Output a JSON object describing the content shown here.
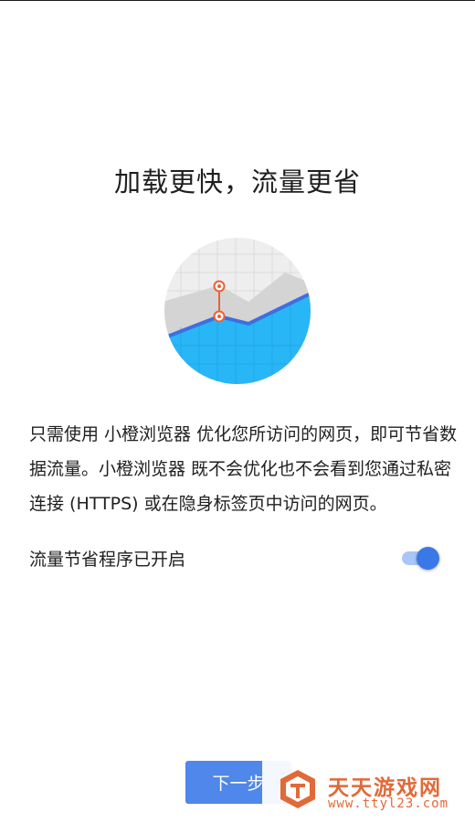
{
  "page": {
    "title": "加载更快，流量更省",
    "description": "只需使用 小橙浏览器 优化您所访问的网页，即可节省数据流量。小橙浏览器 既不会优化也不会看到您通过私密连接 (HTTPS) 或在隐身标签页中访问的网页。",
    "illustration_icon": "data-saver-chart-illustration"
  },
  "toggle": {
    "label": "流量节省程序已开启",
    "state": "on"
  },
  "footer": {
    "next_label": "下一步"
  },
  "watermark": {
    "name": "天天游戏网",
    "url": "www.ttyl23.com"
  },
  "colors": {
    "accent": "#4f87ea",
    "switch_thumb": "#3b78e7",
    "switch_track": "#a8c6f7",
    "chart_blue": "#29b6f6",
    "chart_line": "#3f6ee0",
    "marker_orange": "#e8623c",
    "watermark_orange": "#e06a38"
  }
}
